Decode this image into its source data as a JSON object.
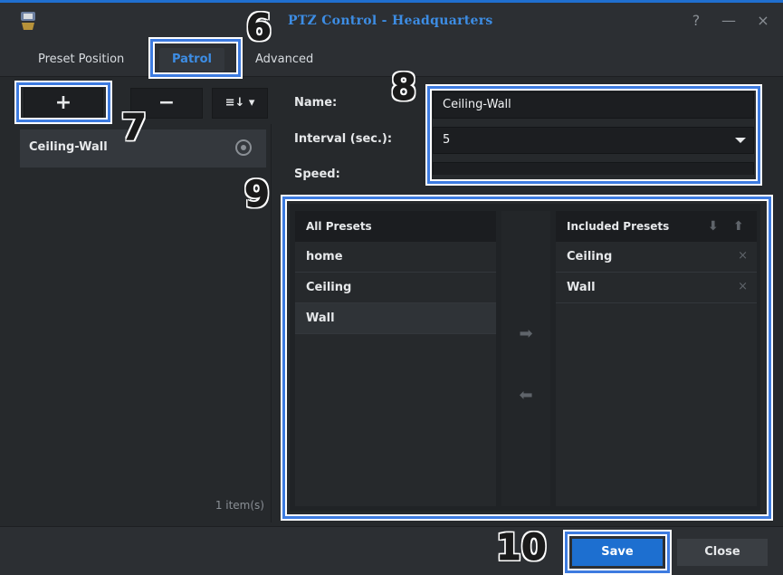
{
  "window": {
    "title": "PTZ Control - Headquarters",
    "controls": {
      "help": "?",
      "minimize": "—",
      "close": "×"
    },
    "app_icon": "camera-app-icon"
  },
  "tabs": [
    {
      "label": "Preset Position",
      "active": false
    },
    {
      "label": "Patrol",
      "active": true
    },
    {
      "label": "Advanced",
      "active": false
    }
  ],
  "left_panel": {
    "toolbar": {
      "add": "+",
      "remove": "−",
      "sort": "≡↓ ▾"
    },
    "items": [
      {
        "label": "Ceiling-Wall"
      }
    ],
    "count": "1 item(s)"
  },
  "form": {
    "name_label": "Name:",
    "name_value": "Ceiling-Wall",
    "interval_label": "Interval (sec.):",
    "interval_value": "5",
    "speed_label": "Speed:"
  },
  "presets": {
    "all_header": "All Presets",
    "all_items": [
      "home",
      "Ceiling",
      "Wall"
    ],
    "included_header": "Included Presets",
    "included_items": [
      "Ceiling",
      "Wall"
    ],
    "move_right": "➡",
    "move_left": "⬅",
    "move_up": "⬆",
    "move_down": "⬇",
    "remove_glyph": "×"
  },
  "buttons": {
    "save": "Save",
    "close": "Close"
  },
  "callouts": {
    "c6": "6",
    "c7": "7",
    "c8": "8",
    "c9": "9",
    "c10": "10"
  },
  "colors": {
    "accent": "#3d7be0",
    "save_bg": "#1d6fd0",
    "title": "#3d8de4"
  }
}
